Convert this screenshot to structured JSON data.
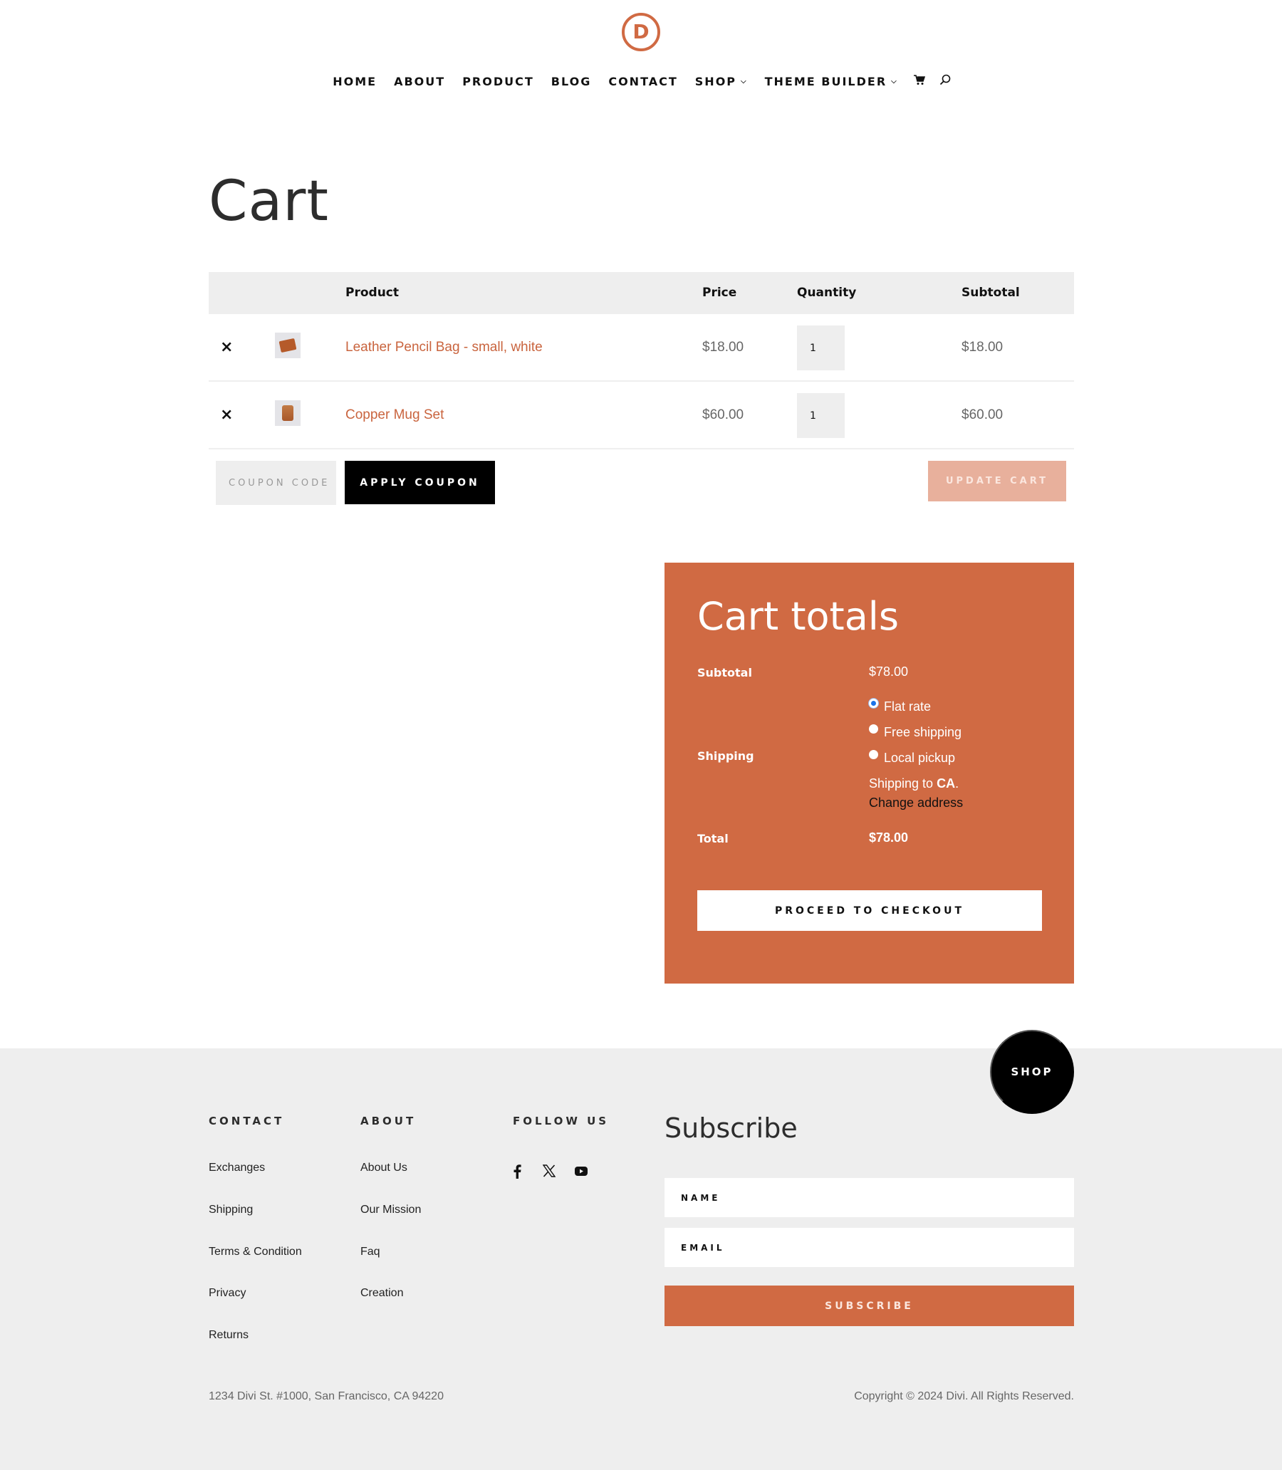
{
  "brand": {
    "logo_letter": "D",
    "accent_color": "#d06a43"
  },
  "nav": {
    "items": [
      {
        "label": "HOME",
        "has_dropdown": false
      },
      {
        "label": "ABOUT",
        "has_dropdown": false
      },
      {
        "label": "PRODUCT",
        "has_dropdown": false
      },
      {
        "label": "BLOG",
        "has_dropdown": false
      },
      {
        "label": "CONTACT",
        "has_dropdown": false
      },
      {
        "label": "SHOP",
        "has_dropdown": true
      },
      {
        "label": "THEME BUILDER",
        "has_dropdown": true
      }
    ],
    "cart_icon": "cart-icon",
    "search_icon": "search-icon"
  },
  "page": {
    "title": "Cart"
  },
  "cart_table": {
    "headers": {
      "product": "Product",
      "price": "Price",
      "quantity": "Quantity",
      "subtotal": "Subtotal"
    },
    "rows": [
      {
        "name": "Leather Pencil Bag - small, white",
        "price": "$18.00",
        "quantity": "1",
        "subtotal": "$18.00"
      },
      {
        "name": "Copper Mug Set",
        "price": "$60.00",
        "quantity": "1",
        "subtotal": "$60.00"
      }
    ],
    "remove_symbol": "×"
  },
  "coupon": {
    "placeholder": "COUPON CODE",
    "apply_label": "APPLY COUPON",
    "update_label": "UPDATE CART"
  },
  "totals": {
    "title": "Cart totals",
    "subtotal_label": "Subtotal",
    "subtotal_value": "$78.00",
    "shipping_label": "Shipping",
    "shipping_options": [
      {
        "label": "Flat rate",
        "selected": true
      },
      {
        "label": "Free shipping",
        "selected": false
      },
      {
        "label": "Local pickup",
        "selected": false
      }
    ],
    "shipping_to_prefix": "Shipping to ",
    "shipping_to_region": "CA",
    "shipping_to_suffix": ".",
    "change_address": "Change address",
    "total_label": "Total",
    "total_value": "$78.00",
    "checkout_label": "PROCEED TO CHECKOUT"
  },
  "footer": {
    "shop_button": "SHOP",
    "contact": {
      "heading": "CONTACT",
      "links": [
        "Exchanges",
        "Shipping",
        "Terms & Condition",
        "Privacy",
        "Returns"
      ]
    },
    "about": {
      "heading": "ABOUT",
      "links": [
        "About Us",
        "Our Mission",
        "Faq",
        "Creation"
      ]
    },
    "follow": {
      "heading": "FOLLOW US",
      "icons": [
        "facebook-icon",
        "x-twitter-icon",
        "youtube-icon"
      ]
    },
    "subscribe": {
      "heading": "Subscribe",
      "name_placeholder": "NAME",
      "email_placeholder": "EMAIL",
      "button_label": "SUBSCRIBE"
    },
    "address": "1234 Divi St. #1000, San Francisco, CA 94220",
    "copyright": "Copyright © 2024 Divi. All Rights Reserved."
  }
}
